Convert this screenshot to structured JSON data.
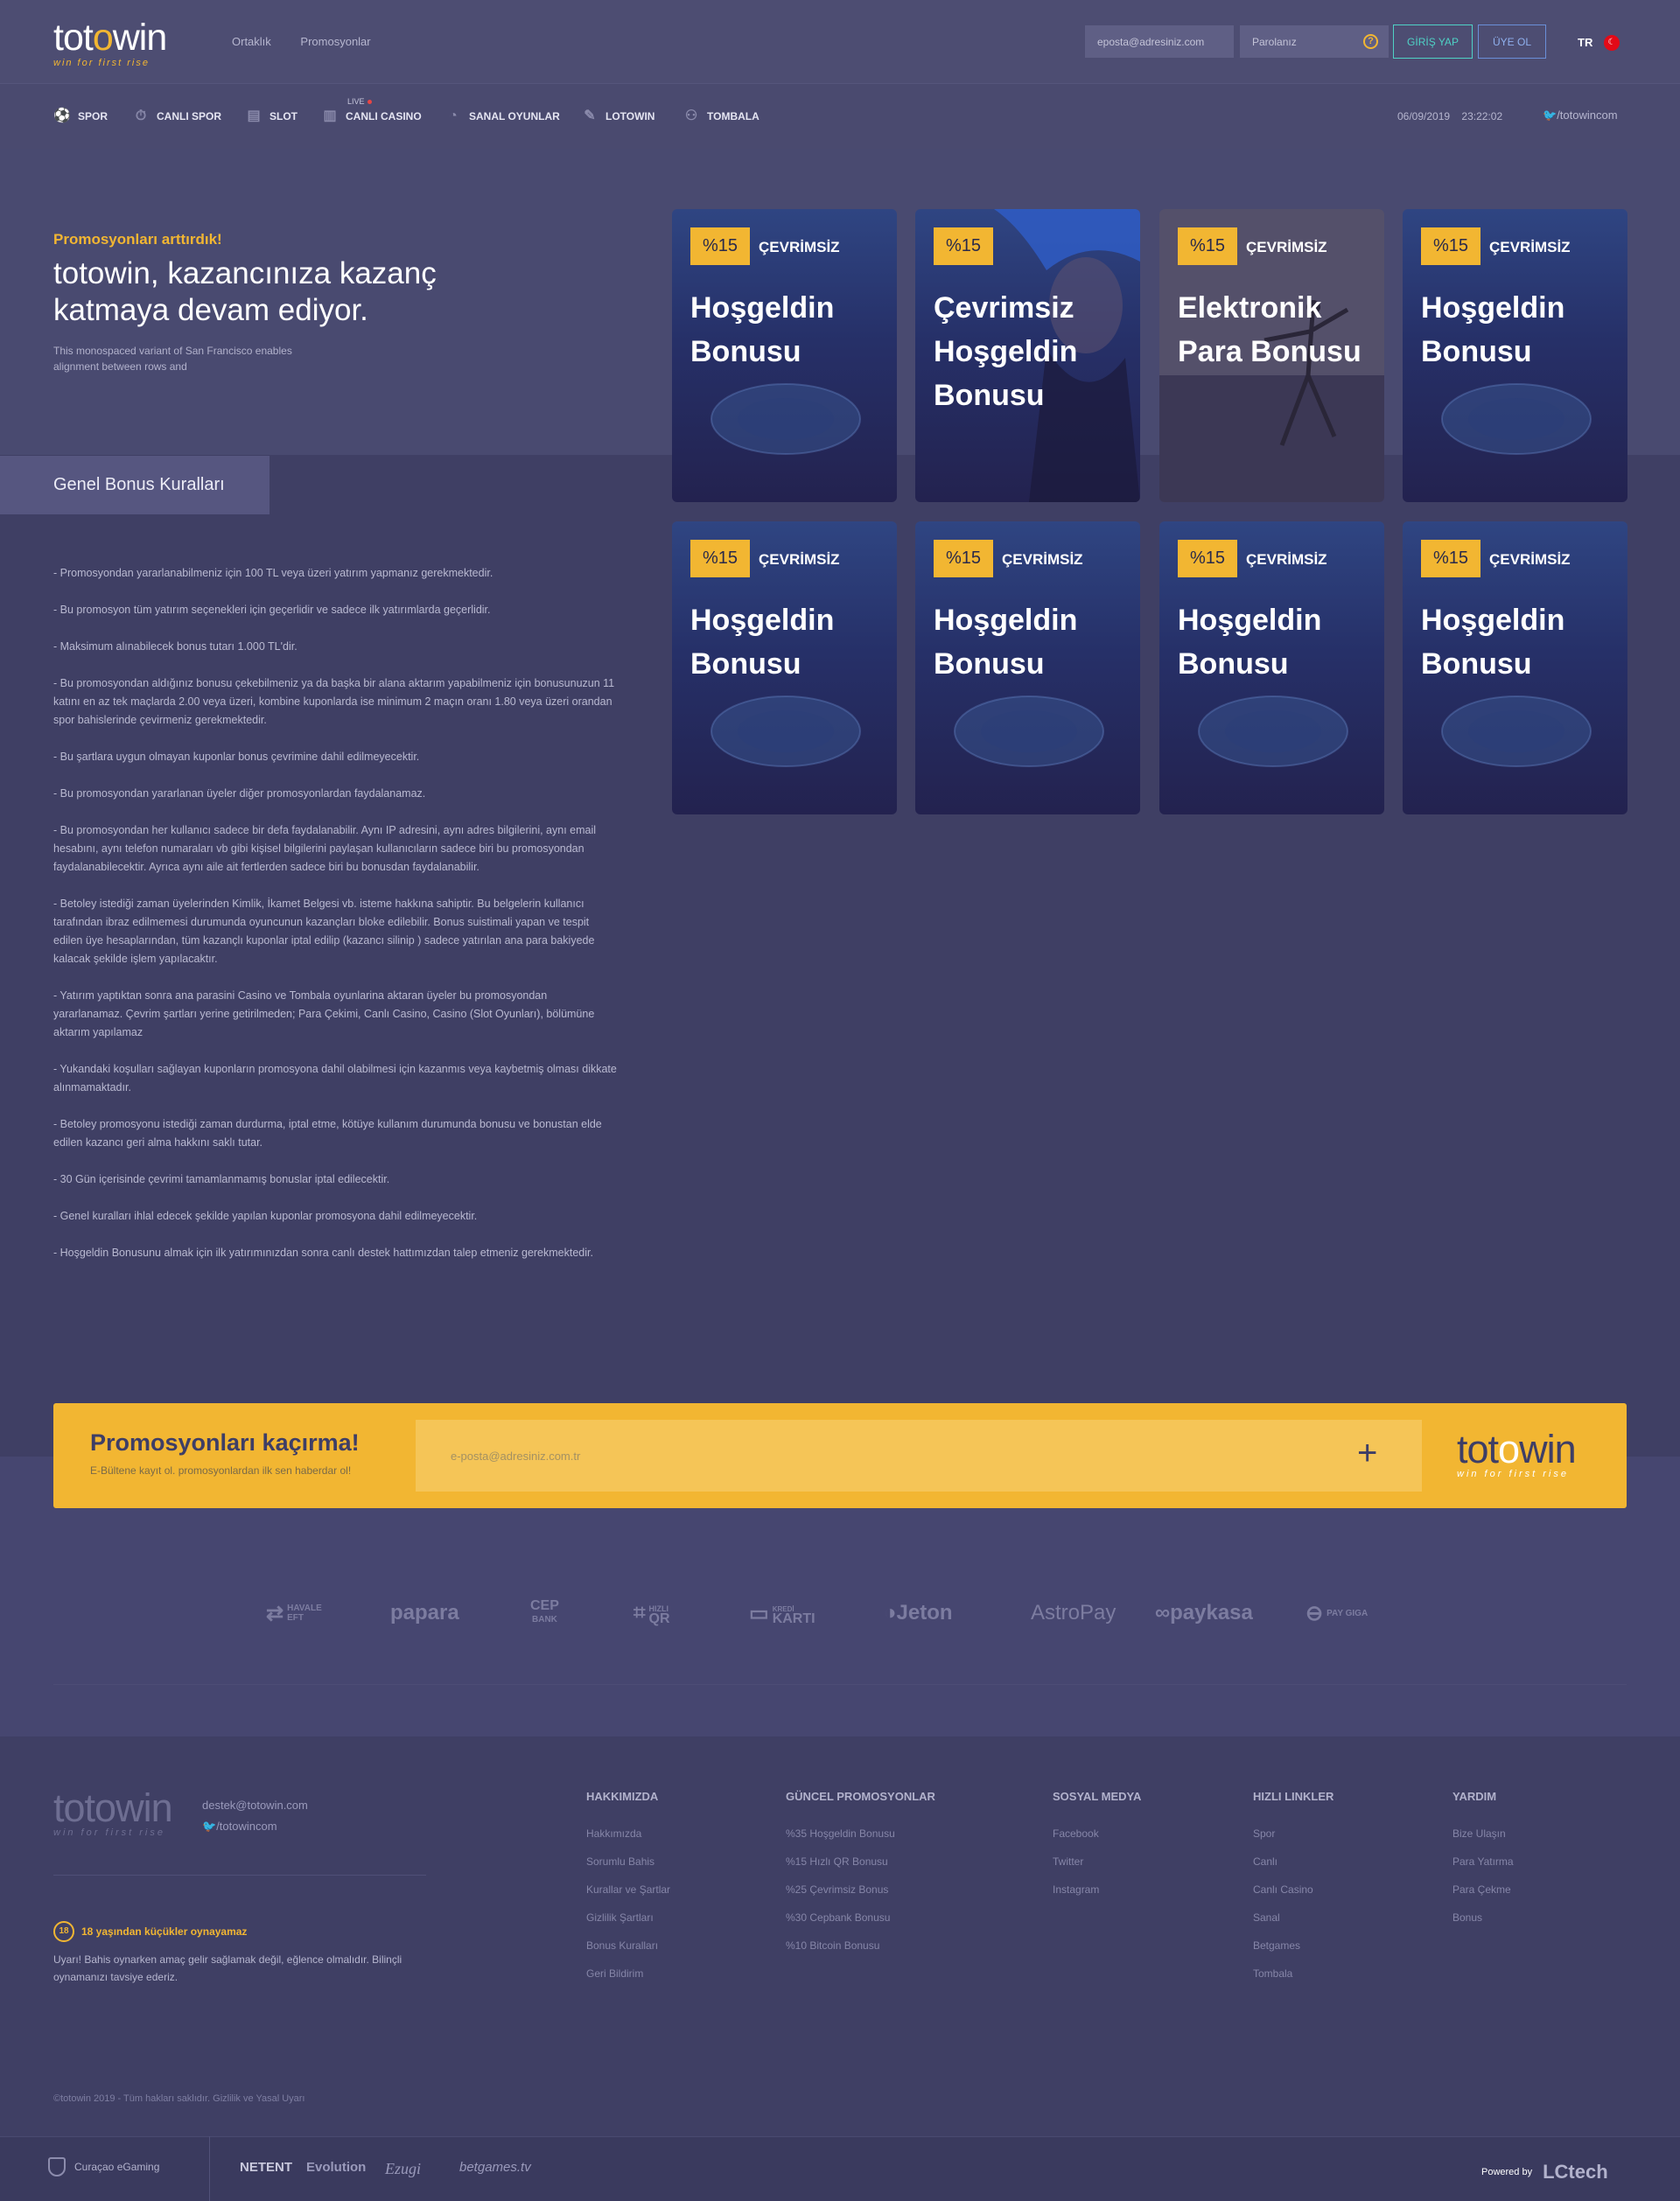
{
  "header": {
    "logo_text_a": "tot",
    "logo_text_accent": "o",
    "logo_text_b": "win",
    "logo_tagline": "win for first rise",
    "links": [
      "Ortaklık",
      "Promosyonlar"
    ],
    "email_placeholder": "eposta@adresiniz.com",
    "password_placeholder": "Parolanız",
    "help_glyph": "?",
    "login_label": "GİRİŞ YAP",
    "register_label": "ÜYE OL",
    "language": "TR"
  },
  "nav": {
    "items": [
      {
        "label": "SPOR",
        "icon": "soccer-ball-icon"
      },
      {
        "label": "CANLI SPOR",
        "icon": "stopwatch-icon"
      },
      {
        "label": "SLOT",
        "icon": "slot-machine-icon"
      },
      {
        "label": "CANLI CASINO",
        "icon": "cards-icon"
      },
      {
        "label": "SANAL OYUNLAR",
        "icon": "virtual-games-icon"
      },
      {
        "label": "LOTOWIN",
        "icon": "lottery-icon"
      },
      {
        "label": "TOMBALA",
        "icon": "bingo-icon"
      }
    ],
    "live_label": "LIVE",
    "date": "06/09/2019",
    "time": "23:22:02",
    "twitter": "/totowincom"
  },
  "hero": {
    "kicker": "Promosyonları arttırdık!",
    "title": "totowin, kazancınıza kazanç katmaya devam ediyor.",
    "subtitle": "This monospaced variant of San Francisco enables alignment between rows and"
  },
  "rules": {
    "tab_label": "Genel Bonus Kuralları",
    "items": [
      "- Promosyondan yararlanabilmeniz için 100 TL veya üzeri yatırım yapmanız gerekmektedir.",
      "- Bu promosyon tüm yatırım seçenekleri için geçerlidir ve sadece ilk yatırımlarda geçerlidir.",
      "- Maksimum alınabilecek bonus tutarı 1.000 TL'dir.",
      "- Bu promosyondan aldığınız bonusu çekebilmeniz ya da başka bir alana aktarım yapabilmeniz için bonusunuzun 11 katını en az tek maçlarda 2.00 veya üzeri, kombine kuponlarda ise minimum 2 maçın oranı 1.80 veya üzeri orandan spor bahislerinde çevirmeniz gerekmektedir.",
      "- Bu şartlara uygun olmayan kuponlar bonus çevrimine dahil edilmeyecektir.",
      "- Bu promosyondan yararlanan üyeler diğer promosyonlardan faydalanamaz.",
      "- Bu promosyondan her kullanıcı sadece bir defa faydalanabilir. Aynı IP adresini, aynı adres bilgilerini, aynı email hesabını, aynı telefon numaraları vb gibi kişisel bilgilerini paylaşan kullanıcıların sadece biri bu promosyondan faydalanabilecektir. Ayrıca aynı aile ait fertlerden sadece biri bu bonusdan faydalanabilir.",
      "- Betoley istediği zaman üyelerinden Kimlik, İkamet Belgesi vb. isteme hakkına sahiptir. Bu belgelerin kullanıcı tarafından ibraz edilmemesi durumunda oyuncunun kazançları bloke edilebilir. Bonus suistimali yapan ve tespit edilen üye hesaplarından, tüm kazançlı kuponlar iptal edilip (kazancı silinip ) sadece yatırılan ana para bakiyede kalacak şekilde işlem yapılacaktır.",
      "- Yatırım yaptıktan sonra ana parasini Casino ve Tombala oyunlarina aktaran üyeler bu promosyondan yararlanamaz. Çevrim şartları yerine getirilmeden; Para Çekimi, Canlı Casino, Casino (Slot Oyunları), bölümüne aktarım yapılamaz",
      "- Yukandaki koşulları sağlayan kuponların promosyona dahil olabilmesi için kazanmıs veya kaybetmiş olması dikkate alınmamaktadır.",
      "- Betoley promosyonu istediği zaman durdurma, iptal etme, kötüye kullanım durumunda bonusu ve bonustan elde edilen kazancı geri alma hakkını saklı tutar.",
      "- 30 Gün içerisinde çevrimi tamamlanmamış bonuslar iptal edilecektir.",
      "- Genel kuralları ihlal edecek şekilde yapılan kuponlar promosyona dahil edilmeyecektir.",
      "- Hoşgeldin Bonusunu almak için ilk yatırımınızdan sonra canlı destek hattımızdan talep etmeniz gerekmektedir."
    ]
  },
  "cards": [
    {
      "badge": "%15",
      "tag": "ÇEVRİMSİZ",
      "title": "Hoşgeldin Bonusu",
      "art": "stadium"
    },
    {
      "badge": "%15",
      "tag": "",
      "title": "Çevrimsiz Hoşgeldin Bonusu",
      "art": "woman"
    },
    {
      "badge": "%15",
      "tag": "ÇEVRİMSİZ",
      "title": "Elektronik Para Bonusu",
      "art": "dancer"
    },
    {
      "badge": "%15",
      "tag": "ÇEVRİMSİZ",
      "title": "Hoşgeldin Bonusu",
      "art": "stadium"
    },
    {
      "badge": "%15",
      "tag": "ÇEVRİMSİZ",
      "title": "Hoşgeldin Bonusu",
      "art": "stadium"
    },
    {
      "badge": "%15",
      "tag": "ÇEVRİMSİZ",
      "title": "Hoşgeldin Bonusu",
      "art": "stadium"
    },
    {
      "badge": "%15",
      "tag": "ÇEVRİMSİZ",
      "title": "Hoşgeldin Bonusu",
      "art": "stadium"
    },
    {
      "badge": "%15",
      "tag": "ÇEVRİMSİZ",
      "title": "Hoşgeldin Bonusu",
      "art": "stadium"
    }
  ],
  "newsletter": {
    "title": "Promosyonları kaçırma!",
    "subtitle": "E-Bültene kayıt ol. promosyonlardan ilk sen haberdar ol!",
    "placeholder": "e-posta@adresiniz.com.tr",
    "plus": "+"
  },
  "payments": [
    {
      "name": "HAVALE",
      "sub": "EFT"
    },
    {
      "name": "papara",
      "sub": ""
    },
    {
      "name": "CEP",
      "sub": "BANK"
    },
    {
      "name": "HIZLI",
      "sub": "QR"
    },
    {
      "name": "KREDİ",
      "sub": "KARTI"
    },
    {
      "name": "Jeton",
      "sub": ""
    },
    {
      "name": "AstroPay",
      "sub": ""
    },
    {
      "name": "paykasa",
      "sub": ""
    },
    {
      "name": "PAY GIGA",
      "sub": ""
    }
  ],
  "footer": {
    "email": "destek@totowin.com",
    "twitter": "/totowincom",
    "age_badge": "18",
    "age_title": "18 yaşından küçükler oynayamaz",
    "age_text": "Uyarı! Bahis oynarken amaç gelir sağlamak değil, eğlence olmalıdır. Bilinçli oynamanızı tavsiye ederiz.",
    "columns": [
      {
        "title": "HAKKIMIZDA",
        "links": [
          "Hakkımızda",
          "Sorumlu Bahis",
          "Kurallar ve Şartlar",
          "Gizlilik Şartları",
          "Bonus Kuralları",
          "Geri Bildirim"
        ]
      },
      {
        "title": "GÜNCEL PROMOSYONLAR",
        "links": [
          "%35 Hoşgeldin Bonusu",
          "%15 Hızlı QR Bonusu",
          "%25 Çevrimsiz Bonus",
          "%30 Cepbank Bonusu",
          "%10 Bitcoin Bonusu"
        ]
      },
      {
        "title": "SOSYAL MEDYA",
        "links": [
          "Facebook",
          "Twitter",
          "Instagram"
        ]
      },
      {
        "title": "HIZLI LINKLER",
        "links": [
          "Spor",
          "Canlı",
          "Canlı Casino",
          "Sanal",
          "Betgames",
          "Tombala"
        ]
      },
      {
        "title": "YARDIM",
        "links": [
          "Bize Ulaşın",
          "Para Yatırma",
          "Para Çekme",
          "Bonus"
        ]
      }
    ],
    "copyright": "©totowin 2019 - Tüm hakları saklıdır. Gizlilik ve Yasal Uyarı",
    "license": "Curaçao eGaming",
    "providers": [
      "NETENT",
      "Evolution",
      "Ezugi",
      "betgames.tv"
    ],
    "powered_by": "Powered by",
    "powered_brand": "LCtech"
  },
  "colors": {
    "accent": "#f2b632",
    "background": "#3f3f64",
    "header": "#4d4d72",
    "login_border": "#4fd1c5",
    "register_border": "#6a8fd8"
  }
}
